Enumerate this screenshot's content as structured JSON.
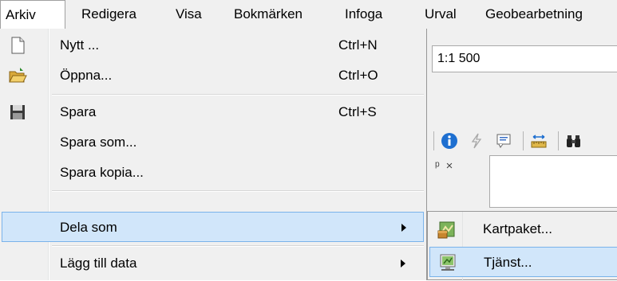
{
  "menubar": {
    "items": [
      "Arkiv",
      "Redigera",
      "Visa",
      "Bokmärken",
      "Infoga",
      "Urval",
      "Geobearbetning"
    ]
  },
  "background": {
    "scale_value": "1:1 500",
    "pin_glyph": "ᵖ",
    "close_glyph": "×"
  },
  "file_menu": {
    "items": [
      {
        "label": "Nytt ...",
        "shortcut": "Ctrl+N",
        "icon": "new-document-icon"
      },
      {
        "label": "Öppna...",
        "shortcut": "Ctrl+O",
        "icon": "open-folder-icon"
      },
      {
        "label": "Spara",
        "shortcut": "Ctrl+S",
        "icon": "save-floppy-icon"
      },
      {
        "label": "Spara som...",
        "shortcut": ""
      },
      {
        "label": "Spara kopia...",
        "shortcut": ""
      },
      {
        "label": "Dela som",
        "shortcut": "",
        "submenu": true
      },
      {
        "label": "Lägg till data",
        "shortcut": "",
        "submenu": true
      }
    ]
  },
  "share_submenu": {
    "items": [
      {
        "label": "Kartpaket...",
        "icon": "map-package-icon"
      },
      {
        "label": "Tjänst...",
        "icon": "service-icon"
      }
    ]
  },
  "colors": {
    "highlight": "#d1e6fa",
    "highlight_border": "#7ab3ea",
    "menu_bg": "#f0f0f0"
  }
}
